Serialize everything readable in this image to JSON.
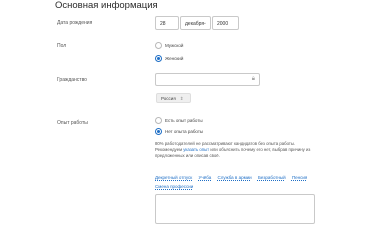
{
  "section": {
    "title": "Основная информация"
  },
  "birthdate": {
    "label": "Дата рождения",
    "day": "28",
    "month": "декабря",
    "year": "2000"
  },
  "gender": {
    "label": "Пол",
    "options": [
      {
        "label": "Мужской",
        "selected": false
      },
      {
        "label": "Женский",
        "selected": true
      }
    ]
  },
  "citizenship": {
    "label": "Гражданство",
    "value": "",
    "tags": [
      "Россия"
    ]
  },
  "experience": {
    "label": "Опыт работы",
    "options": [
      {
        "label": "Есть опыт работы",
        "selected": false
      },
      {
        "label": "Нет опыта работы",
        "selected": true
      }
    ],
    "hint_before": "80% работодателей не рассматривают кандидатов без опыта работы. Рекомендуем ",
    "hint_link": "указать опыт",
    "hint_after": " или объяснить почему его нет, выбрав причину из предложенных или описав своё.",
    "reasons": [
      "Декретный отпуск",
      "Учёба",
      "Служба в армии",
      "Безработный",
      "Пенсия",
      "Смена профессии"
    ]
  }
}
